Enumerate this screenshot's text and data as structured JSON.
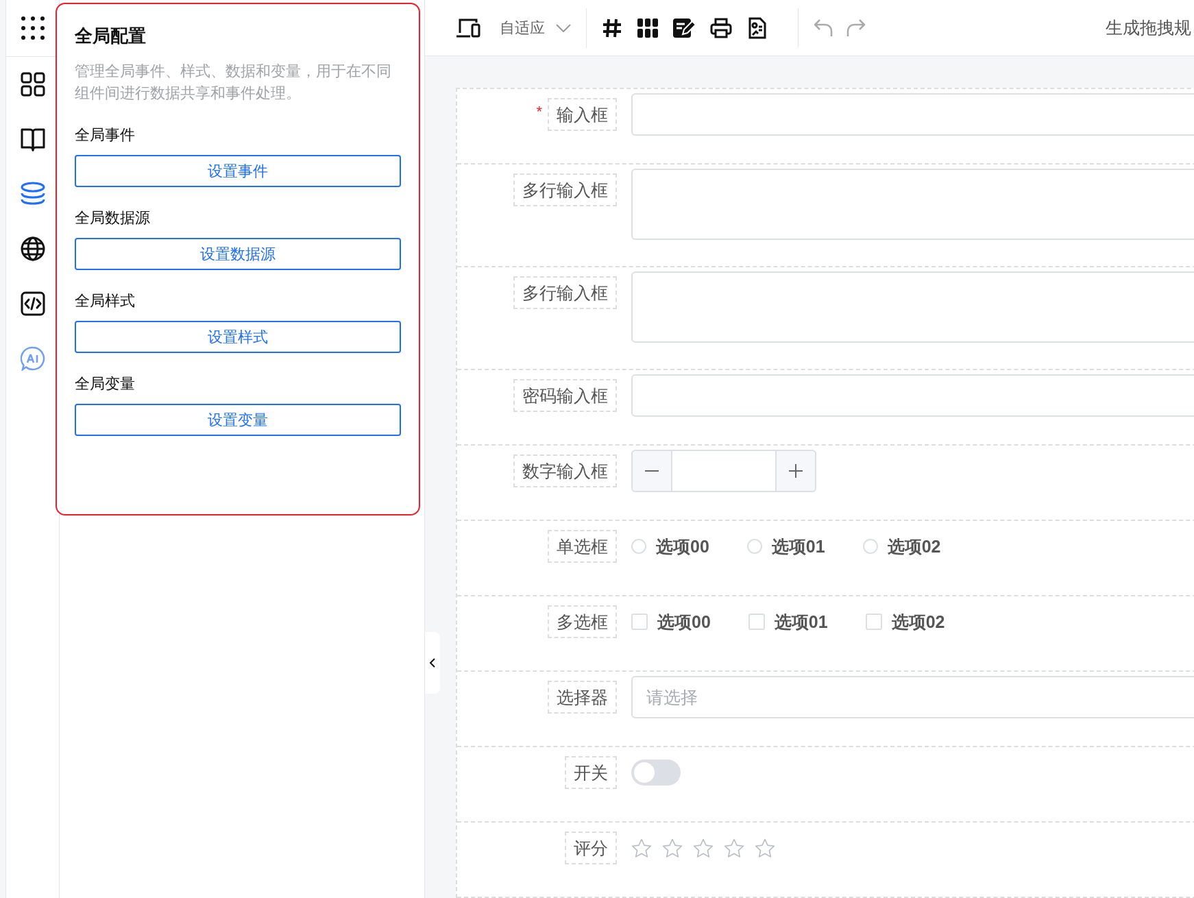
{
  "sidebar": {
    "items": [
      {
        "kind": "grid",
        "selected": false
      },
      {
        "kind": "book",
        "selected": false
      },
      {
        "kind": "database",
        "selected": true
      },
      {
        "kind": "globe",
        "selected": false
      },
      {
        "kind": "code",
        "selected": false
      },
      {
        "kind": "ai",
        "selected": false
      }
    ]
  },
  "panel": {
    "title": "全局配置",
    "description": "管理全局事件、样式、数据和变量，用于在不同组件间进行数据共享和事件处理。",
    "sections": [
      {
        "heading": "全局事件",
        "button": "设置事件"
      },
      {
        "heading": "全局数据源",
        "button": "设置数据源"
      },
      {
        "heading": "全局样式",
        "button": "设置样式"
      },
      {
        "heading": "全局变量",
        "button": "设置变量"
      }
    ]
  },
  "toolbar": {
    "device_mode": "自适应",
    "history": [
      {
        "kind": "undo",
        "disabled": true
      },
      {
        "kind": "redo",
        "disabled": true
      }
    ],
    "action": "生成拖拽规"
  },
  "form": {
    "fields": [
      {
        "kind": "input",
        "label": "输入框",
        "required_mark": "*"
      },
      {
        "kind": "textarea",
        "label": "多行输入框"
      },
      {
        "kind": "textarea",
        "label": "多行输入框"
      },
      {
        "kind": "password",
        "label": "密码输入框"
      },
      {
        "kind": "number",
        "label": "数字输入框"
      },
      {
        "kind": "radio",
        "label": "单选框",
        "options": [
          {
            "label": "选项00",
            "selected": false
          },
          {
            "label": "选项01",
            "selected": false
          },
          {
            "label": "选项02",
            "selected": false
          }
        ]
      },
      {
        "kind": "checkbox",
        "label": "多选框",
        "options": [
          {
            "label": "选项00",
            "checked": false
          },
          {
            "label": "选项01",
            "checked": false
          },
          {
            "label": "选项02",
            "checked": false
          }
        ]
      },
      {
        "kind": "select",
        "label": "选择器",
        "placeholder": "请选择"
      },
      {
        "kind": "switch",
        "label": "开关",
        "on": false
      },
      {
        "kind": "rate",
        "label": "评分",
        "stars": 0
      }
    ]
  }
}
